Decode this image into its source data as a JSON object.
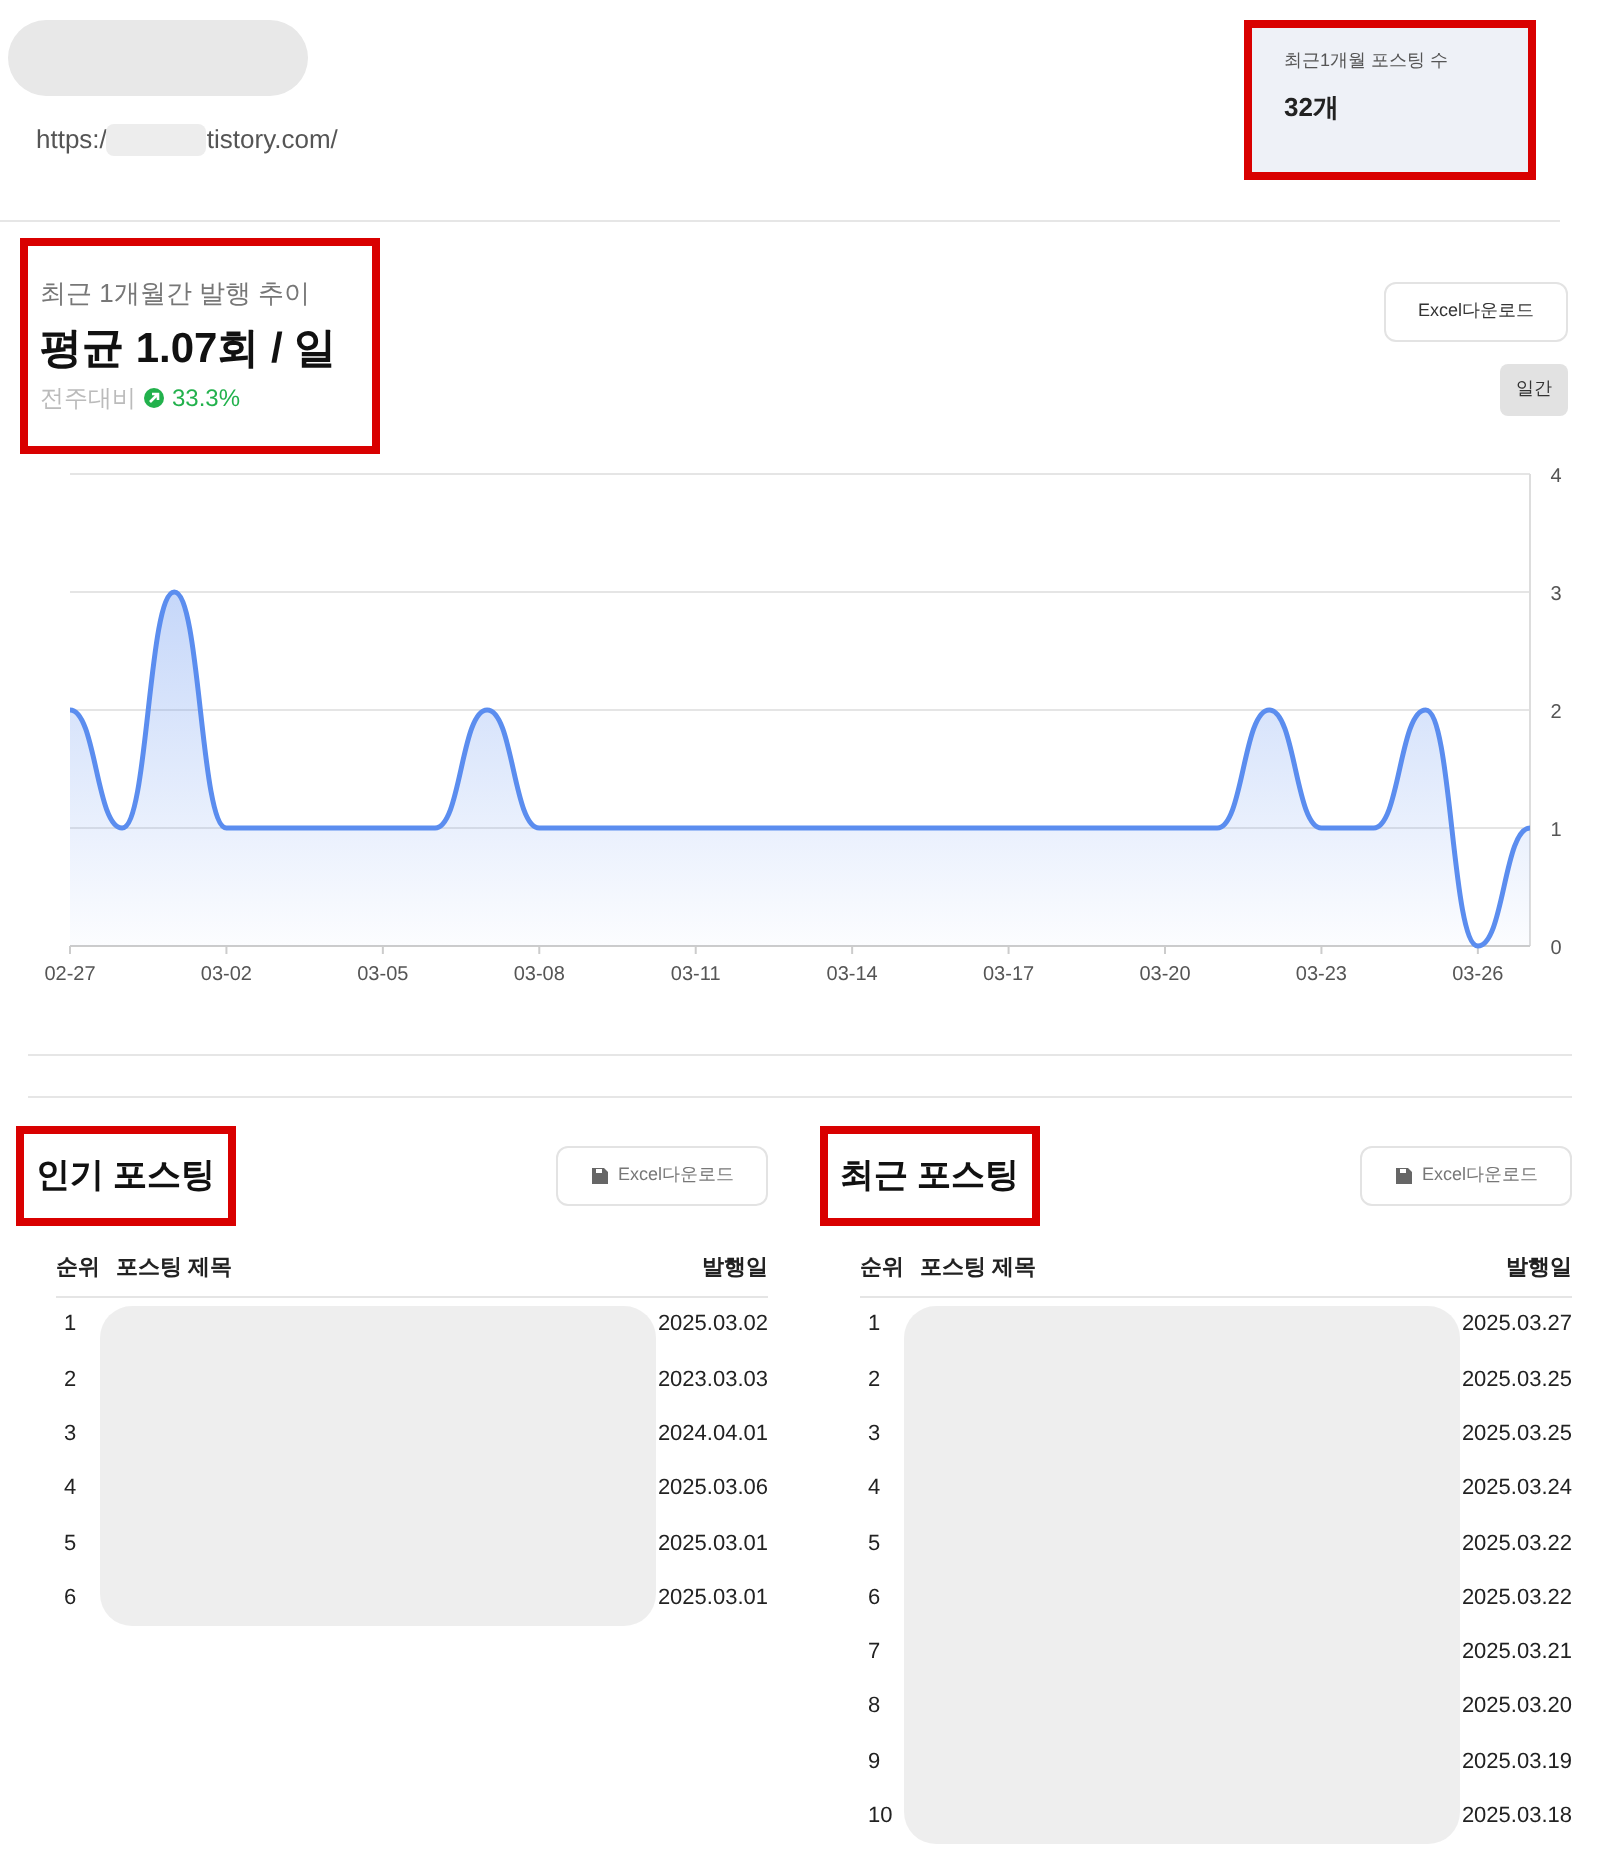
{
  "site": {
    "url_start": "https:/",
    "url_end": "tistory.com/"
  },
  "monthly_count": {
    "label": "최근1개월 포스팅 수",
    "value": "32개",
    "highlighted": true
  },
  "trend": {
    "title": "최근 1개월간 발행 추이",
    "average": "평균 1.07회 / 일",
    "compare_label": "전주대비",
    "change": "33.3%",
    "highlighted": true,
    "excel_button": "Excel다운로드",
    "period_button": "일간",
    "chart_data": {
      "type": "area",
      "categories": [
        "02-27",
        null,
        null,
        "03-02",
        null,
        null,
        "03-05",
        null,
        null,
        "03-08",
        null,
        null,
        "03-11",
        null,
        null,
        "03-14",
        null,
        null,
        "03-17",
        null,
        null,
        "03-20",
        null,
        null,
        "03-23",
        null,
        null,
        "03-26",
        null
      ],
      "series": [
        {
          "color": "#5b8def",
          "values": [
            2,
            1,
            3,
            1,
            1,
            1,
            1,
            1,
            2,
            1,
            1,
            1,
            1,
            1,
            1,
            1,
            1,
            1,
            1,
            1,
            1,
            1,
            1,
            2,
            1,
            1,
            2,
            0,
            1
          ]
        }
      ],
      "ylim": [
        0,
        4
      ],
      "grid": true,
      "yticks": [
        0,
        1,
        2,
        3,
        4
      ]
    }
  },
  "tables": [
    {
      "title": "인기 포스팅",
      "highlighted": true,
      "excel_button": "Excel다운로드",
      "columns": [
        "순위",
        "포스팅 제목",
        "발행일"
      ],
      "rows": [
        {
          "rank": "1",
          "date": "2025.03.02"
        },
        {
          "rank": "2",
          "date": "2023.03.03"
        },
        {
          "rank": "3",
          "date": "2024.04.01"
        },
        {
          "rank": "4",
          "date": "2025.03.06"
        },
        {
          "rank": "5",
          "date": "2025.03.01"
        },
        {
          "rank": "6",
          "date": "2025.03.01"
        }
      ]
    },
    {
      "title": "최근 포스팅",
      "highlighted": true,
      "excel_button": "Excel다운로드",
      "columns": [
        "순위",
        "포스팅 제목",
        "발행일"
      ],
      "rows": [
        {
          "rank": "1",
          "date": "2025.03.27"
        },
        {
          "rank": "2",
          "date": "2025.03.25"
        },
        {
          "rank": "3",
          "date": "2025.03.25"
        },
        {
          "rank": "4",
          "date": "2025.03.24"
        },
        {
          "rank": "5",
          "date": "2025.03.22"
        },
        {
          "rank": "6",
          "date": "2025.03.22"
        },
        {
          "rank": "7",
          "date": "2025.03.21"
        },
        {
          "rank": "8",
          "date": "2025.03.20"
        },
        {
          "rank": "9",
          "date": "2025.03.19"
        },
        {
          "rank": "10",
          "date": "2025.03.18"
        }
      ]
    }
  ]
}
